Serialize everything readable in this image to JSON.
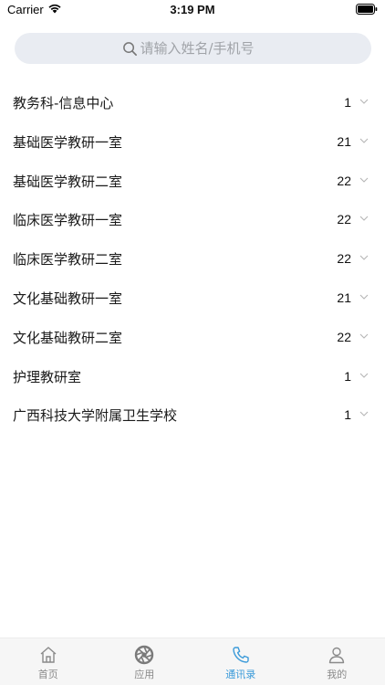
{
  "status_bar": {
    "carrier": "Carrier",
    "time": "3:19 PM"
  },
  "search": {
    "placeholder": "请输入姓名/手机号",
    "value": ""
  },
  "departments": [
    {
      "name": "教务科-信息中心",
      "count": "1"
    },
    {
      "name": "基础医学教研一室",
      "count": "21"
    },
    {
      "name": "基础医学教研二室",
      "count": "22"
    },
    {
      "name": "临床医学教研一室",
      "count": "22"
    },
    {
      "name": "临床医学教研二室",
      "count": "22"
    },
    {
      "name": "文化基础教研一室",
      "count": "21"
    },
    {
      "name": "文化基础教研二室",
      "count": "22"
    },
    {
      "name": "护理教研室",
      "count": "1"
    },
    {
      "name": "广西科技大学附属卫生学校",
      "count": "1"
    }
  ],
  "tab_bar": {
    "active_color": "#3a9ad9",
    "tabs": [
      {
        "label": "首页",
        "icon": "home-icon"
      },
      {
        "label": "应用",
        "icon": "aperture-icon"
      },
      {
        "label": "通讯录",
        "icon": "phone-icon",
        "active": true
      },
      {
        "label": "我的",
        "icon": "person-icon"
      }
    ]
  }
}
